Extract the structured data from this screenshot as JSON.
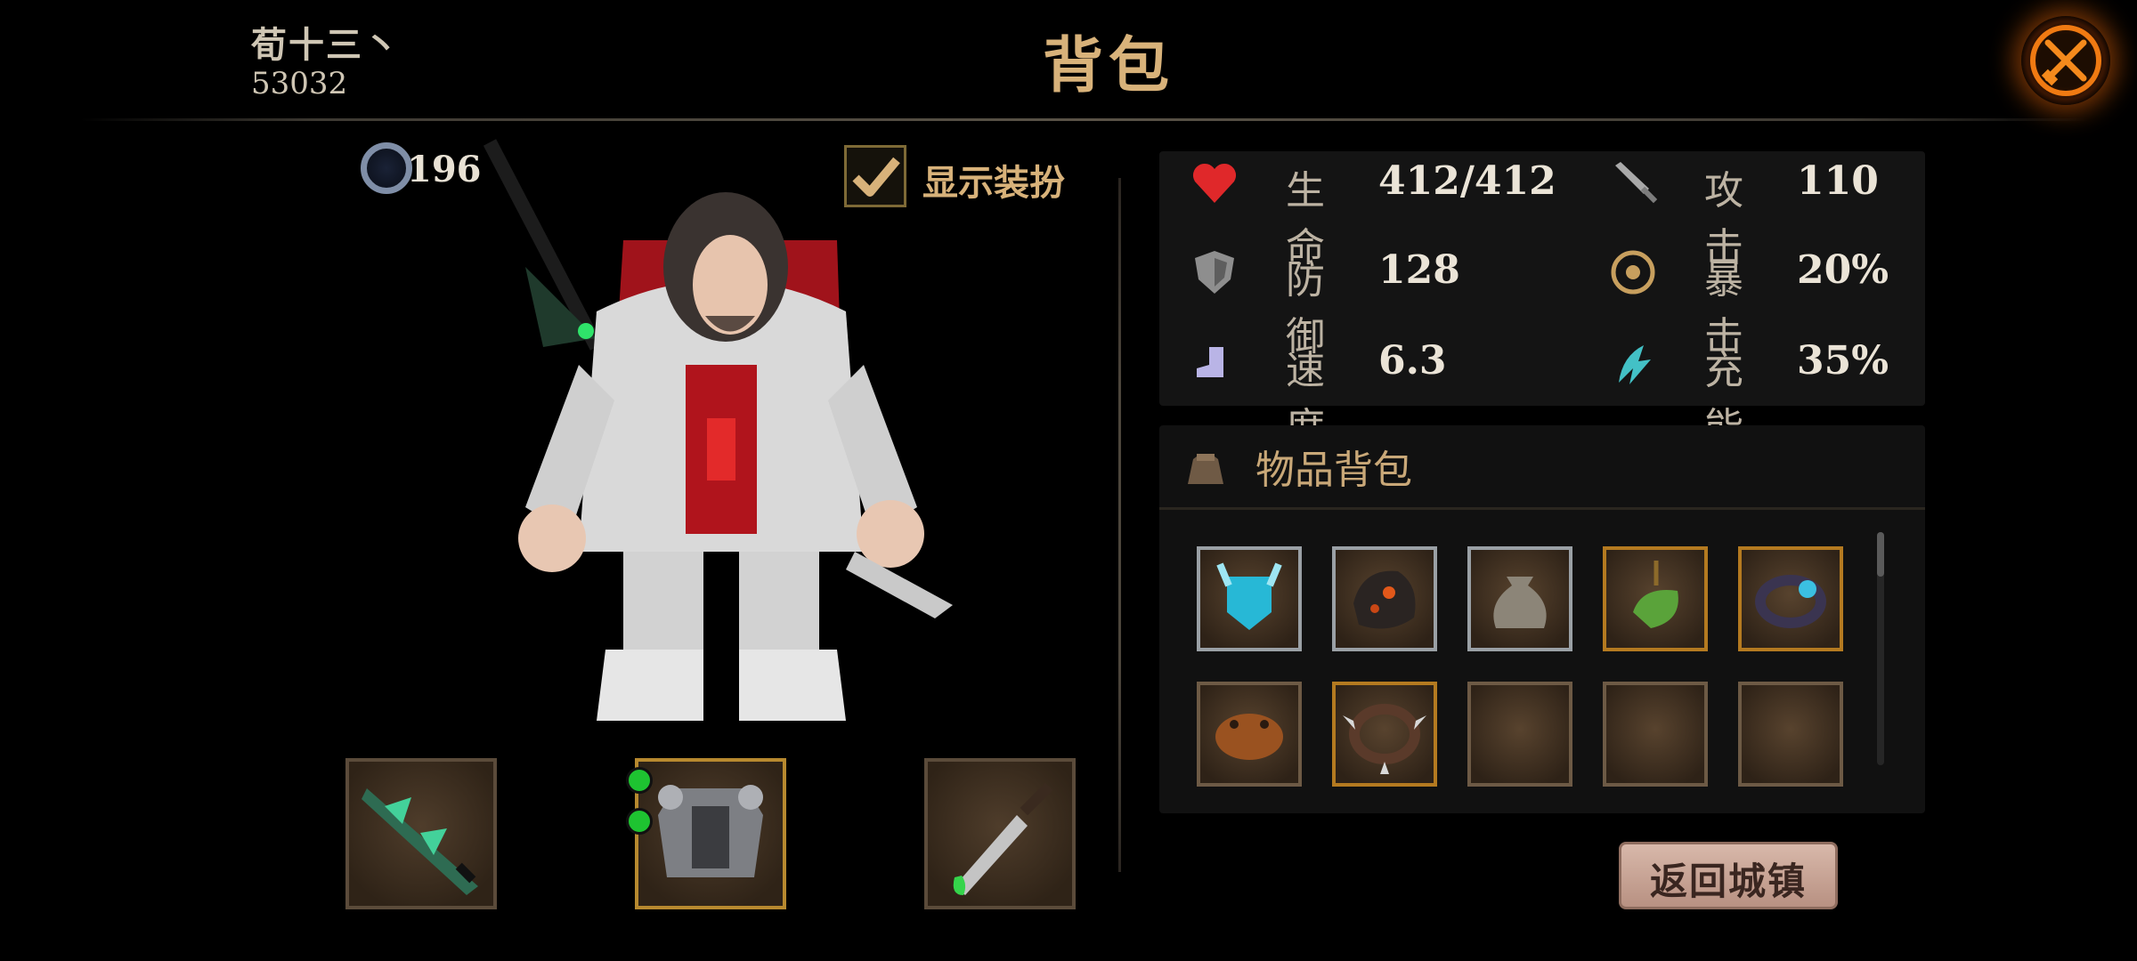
{
  "header": {
    "player_name": "荀十三丶",
    "player_id": "53032",
    "title": "背包"
  },
  "character": {
    "level": "196",
    "show_costume_label": "显示装扮",
    "show_costume_checked": true,
    "equipment_slots": [
      {
        "item": "green-spiked-sword",
        "frame": "plain"
      },
      {
        "item": "steel-armor",
        "frame": "gold",
        "gem_sockets": 2
      },
      {
        "item": "poison-dagger",
        "frame": "plain"
      }
    ]
  },
  "stats": [
    {
      "icon": "heart-icon",
      "label": "生命",
      "value": "412/412",
      "color": "#e0282a"
    },
    {
      "icon": "sword-icon",
      "label": "攻击",
      "value": "110",
      "color": "#a9a9a9"
    },
    {
      "icon": "shield-icon",
      "label": "防御",
      "value": "128",
      "color": "#9a9a9a"
    },
    {
      "icon": "crit-icon",
      "label": "暴击",
      "value": "20%",
      "color": "#c79f5e"
    },
    {
      "icon": "boot-icon",
      "label": "速度",
      "value": "6.3",
      "color": "#b9b4e6"
    },
    {
      "icon": "energy-icon",
      "label": "充能",
      "value": "35%",
      "color": "#43c1c6"
    }
  ],
  "inventory": {
    "title": "物品背包",
    "items": [
      {
        "item": "cyan-emblem",
        "frame": "gray"
      },
      {
        "item": "lava-ore",
        "frame": "gray"
      },
      {
        "item": "sack",
        "frame": "gray"
      },
      {
        "item": "green-amulet",
        "frame": "orange"
      },
      {
        "item": "dark-bracelet",
        "frame": "orange"
      },
      {
        "item": "frog-hat",
        "frame": "plain"
      },
      {
        "item": "spiked-collar",
        "frame": "orange"
      },
      {
        "item": null,
        "frame": "plain"
      },
      {
        "item": null,
        "frame": "plain"
      },
      {
        "item": null,
        "frame": "plain"
      }
    ]
  },
  "return_button": "返回城镇",
  "colors": {
    "title_gold": "#d8b27a",
    "close_glow": "#e0620a",
    "panel_bg": "#141414"
  }
}
